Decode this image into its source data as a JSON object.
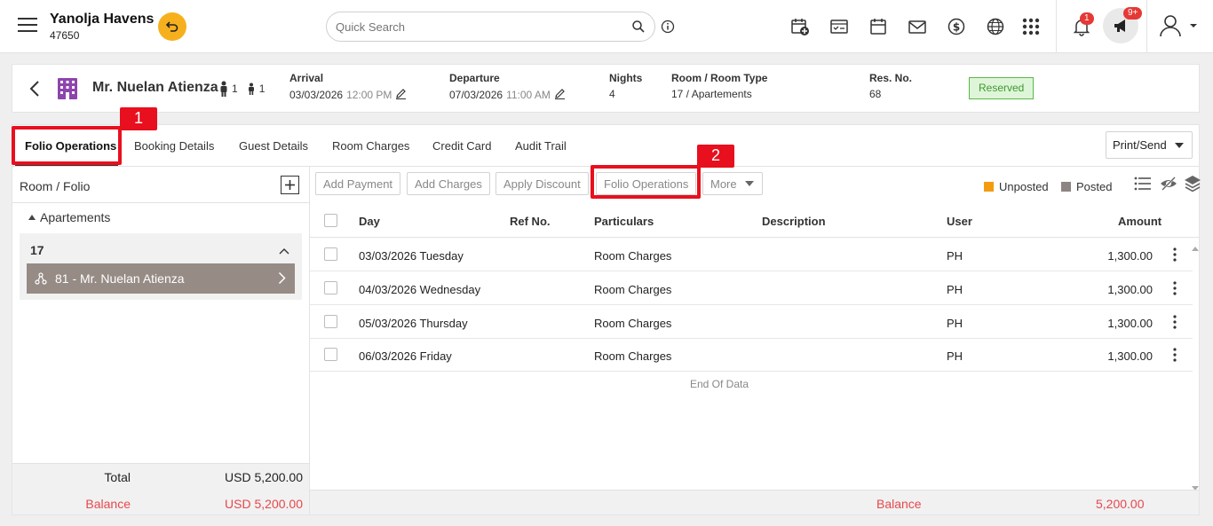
{
  "property": {
    "name": "Yanolja Havens",
    "id": "47650"
  },
  "search": {
    "placeholder": "Quick Search"
  },
  "notifications": {
    "count": "1",
    "announcements": "9+"
  },
  "icons": [
    "menu-icon",
    "undo-icon",
    "search-icon",
    "info-icon",
    "calendar-add-icon",
    "checklist-icon",
    "calendar-icon",
    "mail-icon",
    "dollar-icon",
    "globe-icon",
    "apps-grid-icon",
    "bell-icon",
    "megaphone-icon",
    "user-icon",
    "chevron-left-icon",
    "building-icon",
    "plus-icon",
    "kebab-icon",
    "list-icon",
    "eye-off-icon",
    "layers-icon"
  ],
  "guest": {
    "name": "Mr. Nuelan Atienza",
    "adults": "1",
    "children": "1",
    "arrival_label": "Arrival",
    "arrival_date": "03/03/2026",
    "arrival_time": "12:00 PM",
    "departure_label": "Departure",
    "departure_date": "07/03/2026",
    "departure_time": "11:00 AM",
    "nights_label": "Nights",
    "nights": "4",
    "room_label": "Room / Room Type",
    "room": "17 / Apartements",
    "resno_label": "Res. No.",
    "resno": "68",
    "status": "Reserved"
  },
  "colors": {
    "accent": "#f6b01e",
    "reserved": "#59b84a",
    "unposted": "#f39c12",
    "posted": "#8c8584",
    "balance": "#e5484d",
    "callout": "#e8101e",
    "folio_selected": "#968b85"
  },
  "tabs": [
    {
      "label": "Folio Operations"
    },
    {
      "label": "Booking Details"
    },
    {
      "label": "Guest Details"
    },
    {
      "label": "Room Charges"
    },
    {
      "label": "Credit Card"
    },
    {
      "label": "Audit Trail"
    }
  ],
  "print_send": "Print/Send",
  "left_panel": {
    "title": "Room / Folio",
    "group": "Apartements",
    "room": "17",
    "folio": "81 - Mr. Nuelan Atienza",
    "total_label": "Total",
    "total": "USD 5,200.00",
    "balance_label": "Balance",
    "balance": "USD 5,200.00"
  },
  "toolbar": {
    "add_payment": "Add Payment",
    "add_charges": "Add Charges",
    "apply_discount": "Apply Discount",
    "folio_operations": "Folio Operations",
    "more": "More",
    "unposted": "Unposted",
    "posted": "Posted"
  },
  "table": {
    "columns": [
      "Day",
      "Ref No.",
      "Particulars",
      "Description",
      "User",
      "Amount"
    ],
    "rows": [
      {
        "day": "03/03/2026 Tuesday",
        "ref": "",
        "particulars": "Room Charges",
        "description": "",
        "user": "PH",
        "amount": "1,300.00"
      },
      {
        "day": "04/03/2026 Wednesday",
        "ref": "",
        "particulars": "Room Charges",
        "description": "",
        "user": "PH",
        "amount": "1,300.00"
      },
      {
        "day": "05/03/2026 Thursday",
        "ref": "",
        "particulars": "Room Charges",
        "description": "",
        "user": "PH",
        "amount": "1,300.00"
      },
      {
        "day": "06/03/2026 Friday",
        "ref": "",
        "particulars": "Room Charges",
        "description": "",
        "user": "PH",
        "amount": "1,300.00"
      }
    ],
    "end_text": "End Of Data",
    "balance_label": "Balance",
    "balance": "5,200.00"
  },
  "callouts": {
    "one": "1",
    "two": "2"
  }
}
